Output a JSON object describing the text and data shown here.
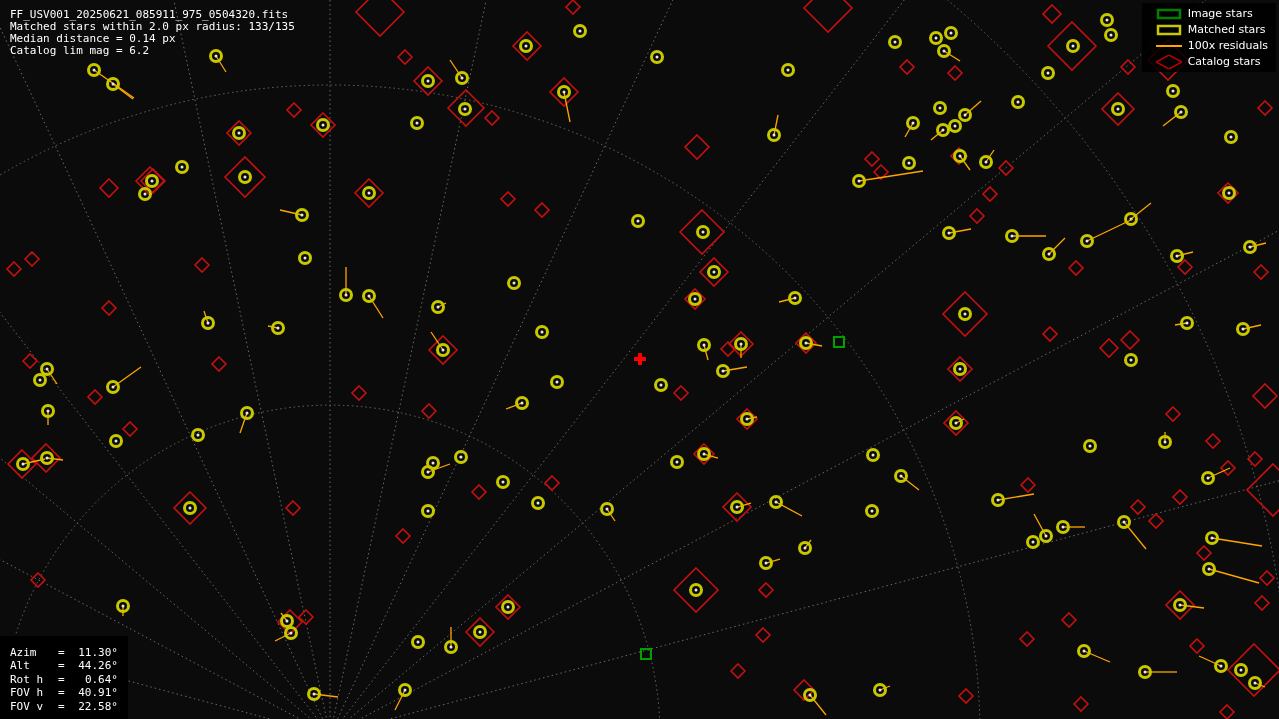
{
  "info_lines": [
    "FF_USV001_20250621_085911_975_0504320.fits",
    "Matched stars within 2.0 px radius: 133/135",
    "Median distance = 0.14 px",
    "Catalog lim mag = 6.2"
  ],
  "legend": [
    {
      "kind": "box",
      "color": "#008000",
      "label": "Image stars"
    },
    {
      "kind": "box",
      "color": "#c8c800",
      "label": "Matched stars"
    },
    {
      "kind": "line",
      "color": "#ffa500",
      "label": "100x residuals"
    },
    {
      "kind": "diamond",
      "color": "#c00000",
      "label": "Catalog stars"
    }
  ],
  "pointing": [
    {
      "label": "Azim",
      "sign": "=",
      "value": "11.30°"
    },
    {
      "label": "Alt",
      "sign": "=",
      "value": "44.26°"
    },
    {
      "label": "Rot h",
      "sign": "=",
      "value": "0.64°"
    },
    {
      "label": "FOV h",
      "sign": "=",
      "value": "40.91°"
    },
    {
      "label": "FOV v",
      "sign": "=",
      "value": "22.58°"
    }
  ]
}
